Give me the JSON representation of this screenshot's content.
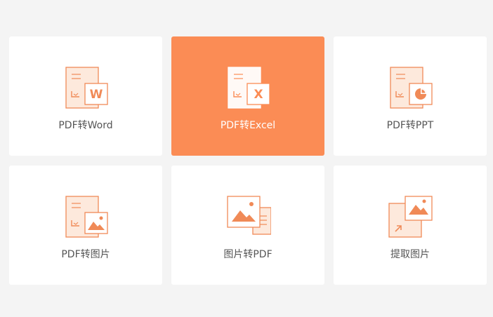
{
  "colors": {
    "accent": "#fb8c55",
    "line": "#f08a57",
    "fill": "#fde9dc",
    "card_bg": "#ffffff",
    "page_bg": "#f4f4f4"
  },
  "tools": [
    {
      "label": "PDF转Word",
      "icon": "pdf-to-word-icon",
      "badge": "W",
      "active": false
    },
    {
      "label": "PDF转Excel",
      "icon": "pdf-to-excel-icon",
      "badge": "X",
      "active": true
    },
    {
      "label": "PDF转PPT",
      "icon": "pdf-to-ppt-icon",
      "badge": "",
      "active": false
    },
    {
      "label": "PDF转图片",
      "icon": "pdf-to-image-icon",
      "badge": "",
      "active": false
    },
    {
      "label": "图片转PDF",
      "icon": "image-to-pdf-icon",
      "badge": "",
      "active": false
    },
    {
      "label": "提取图片",
      "icon": "extract-image-icon",
      "badge": "",
      "active": false
    }
  ]
}
